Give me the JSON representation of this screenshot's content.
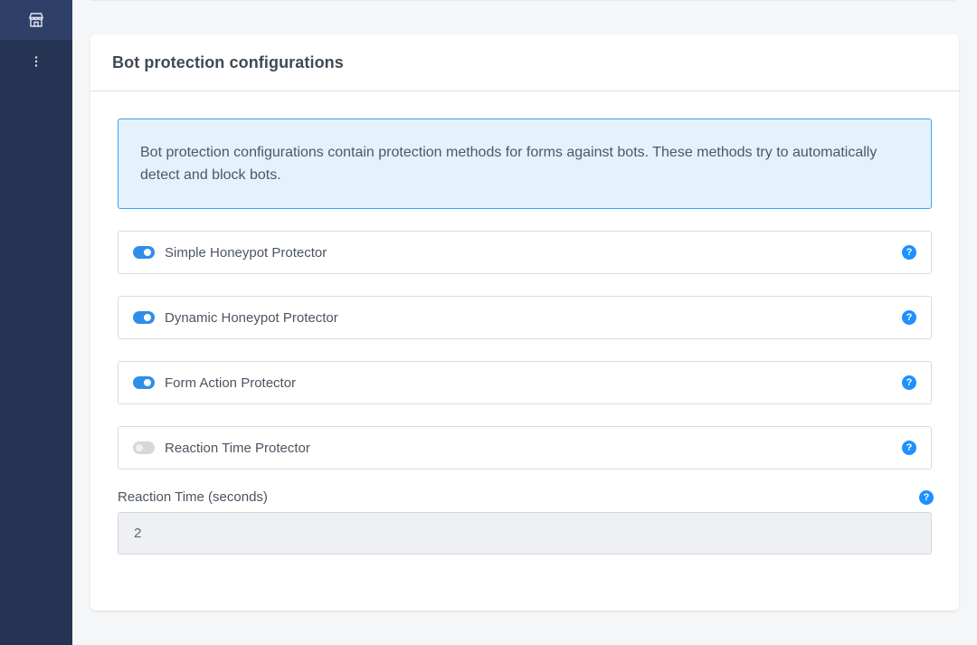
{
  "sidebar": {
    "items": [
      {
        "icon": "store-icon",
        "active": true
      },
      {
        "icon": "more-vertical-icon",
        "active": false
      }
    ]
  },
  "card": {
    "title": "Bot protection configurations",
    "info": "Bot protection configurations contain protection methods for forms against bots. These methods try to automatically detect and block bots."
  },
  "options": [
    {
      "label": "Simple Honeypot Protector",
      "enabled": true
    },
    {
      "label": "Dynamic Honeypot Protector",
      "enabled": true
    },
    {
      "label": "Form Action Protector",
      "enabled": true
    },
    {
      "label": "Reaction Time Protector",
      "enabled": false
    }
  ],
  "reaction_time": {
    "label": "Reaction Time (seconds)",
    "value": "2"
  },
  "help_glyph": "?",
  "colors": {
    "sidebar": "#253452",
    "accent": "#2f8ee8",
    "info_bg": "#e3f2fd"
  }
}
